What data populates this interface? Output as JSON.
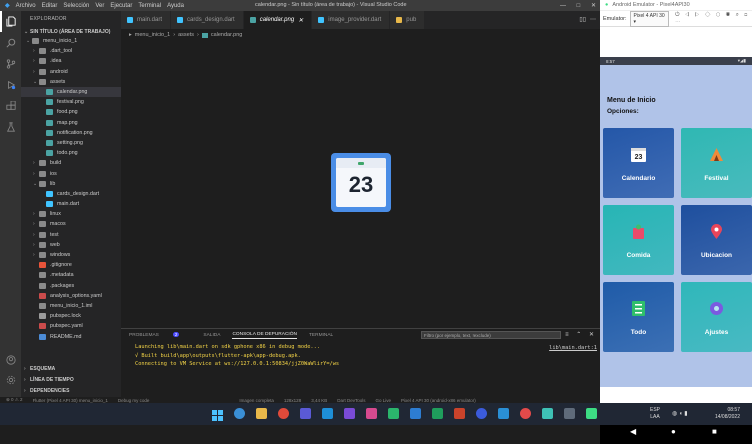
{
  "vscode": {
    "menu": [
      "Archivo",
      "Editar",
      "Selección",
      "Ver",
      "Ejecutar",
      "Terminal",
      "Ayuda"
    ],
    "window_title": "calendar.png - Sin título (área de trabajo) - Visual Studio Code",
    "explorer_header": "EXPLORADOR",
    "workspace": "SIN TÍTULO (ÁREA DE TRABAJO)",
    "tree": [
      {
        "label": "menu_inicio_1",
        "depth": 1,
        "type": "folder-open"
      },
      {
        "label": ".dart_tool",
        "depth": 2,
        "type": "folder"
      },
      {
        "label": ".idea",
        "depth": 2,
        "type": "folder"
      },
      {
        "label": "android",
        "depth": 2,
        "type": "folder"
      },
      {
        "label": "assets",
        "depth": 2,
        "type": "folder-open"
      },
      {
        "label": "calendar.png",
        "depth": 3,
        "type": "png",
        "selected": true
      },
      {
        "label": "festival.png",
        "depth": 3,
        "type": "png"
      },
      {
        "label": "food.png",
        "depth": 3,
        "type": "png"
      },
      {
        "label": "map.png",
        "depth": 3,
        "type": "png"
      },
      {
        "label": "notification.png",
        "depth": 3,
        "type": "png"
      },
      {
        "label": "setting.png",
        "depth": 3,
        "type": "png"
      },
      {
        "label": "todo.png",
        "depth": 3,
        "type": "png"
      },
      {
        "label": "build",
        "depth": 2,
        "type": "folder"
      },
      {
        "label": "ios",
        "depth": 2,
        "type": "folder"
      },
      {
        "label": "lib",
        "depth": 2,
        "type": "folder-open"
      },
      {
        "label": "cards_design.dart",
        "depth": 3,
        "type": "dart"
      },
      {
        "label": "main.dart",
        "depth": 3,
        "type": "dart"
      },
      {
        "label": "linux",
        "depth": 2,
        "type": "folder"
      },
      {
        "label": "macos",
        "depth": 2,
        "type": "folder"
      },
      {
        "label": "test",
        "depth": 2,
        "type": "folder"
      },
      {
        "label": "web",
        "depth": 2,
        "type": "folder"
      },
      {
        "label": "windows",
        "depth": 2,
        "type": "folder"
      },
      {
        "label": ".gitignore",
        "depth": 2,
        "type": "git"
      },
      {
        "label": ".metadata",
        "depth": 2,
        "type": "file"
      },
      {
        "label": ".packages",
        "depth": 2,
        "type": "file"
      },
      {
        "label": "analysis_options.yaml",
        "depth": 2,
        "type": "yaml"
      },
      {
        "label": "menu_inicio_1.iml",
        "depth": 2,
        "type": "file"
      },
      {
        "label": "pubspec.lock",
        "depth": 2,
        "type": "lock"
      },
      {
        "label": "pubspec.yaml",
        "depth": 2,
        "type": "yaml"
      },
      {
        "label": "README.md",
        "depth": 2,
        "type": "md"
      }
    ],
    "bottom_sections": [
      "ESQUEMA",
      "LÍNEA DE TIEMPO",
      "DEPENDENCIES"
    ],
    "tabs": [
      {
        "label": "main.dart",
        "active": false
      },
      {
        "label": "cards_design.dart",
        "active": false
      },
      {
        "label": "calendar.png",
        "active": true
      },
      {
        "label": "image_provider.dart",
        "active": false
      },
      {
        "label": "pub",
        "active": false
      }
    ],
    "breadcrumb": [
      "menu_inicio_1",
      "assets",
      "calendar.png"
    ],
    "preview_number": "23",
    "panel": {
      "tabs": [
        "PROBLEMAS",
        "SALIDA",
        "CONSOLA DE DEPURACIÓN",
        "TERMINAL"
      ],
      "problems_count": "2",
      "active_tab": "CONSOLA DE DEPURACIÓN",
      "filter_placeholder": "Filtro (por ejemplo, text, !exclude)",
      "console_lines": [
        "Launching lib\\main.dart on sdk gphone x86 in debug mode...",
        "√  Built build\\app\\outputs\\flutter-apk\\app-debug.apk.",
        "Connecting to VM Service at ws://127.0.0.1:50834/jjZ0WaWlirY=/ws"
      ],
      "console_link": "lib\\main.dart:1"
    },
    "status": {
      "left": "⊗ 0 ⚠ 2",
      "flutter": "Flutter (Pixel 4 API 30) menu_inicio_1",
      "debug": "Debug my code",
      "image": "Imagen completa",
      "dims": "128x128",
      "size": "3,44 KB",
      "devtools": "Dart DevTools",
      "golive": "Go Live",
      "device": "Pixel 4 API 30 (android-x86 emulator)"
    }
  },
  "emulator": {
    "title": "Android Emulator - Pixel4API30",
    "label": "Emulator:",
    "device": "Pixel 4 API 30",
    "phone_time": "8:57",
    "app_title": "Menu de Inicio",
    "app_subtitle": "Opciones:",
    "cards": [
      {
        "label": "Calendario",
        "icon": "calendar-icon",
        "color": "#2457a8"
      },
      {
        "label": "Festival",
        "icon": "festival-icon",
        "color": "#2fb8b3"
      },
      {
        "label": "Comida",
        "icon": "food-icon",
        "color": "#27b5b5"
      },
      {
        "label": "Ubicacion",
        "icon": "map-pin-icon",
        "color": "#1e4f9e"
      },
      {
        "label": "Todo",
        "icon": "todo-icon",
        "color": "#1f5ba8"
      },
      {
        "label": "Ajustes",
        "icon": "settings-icon",
        "color": "#2fb7ba"
      }
    ]
  },
  "taskbar": {
    "lang": [
      "ESP",
      "LAA"
    ],
    "time": "08:57",
    "date": "14/08/2022"
  }
}
